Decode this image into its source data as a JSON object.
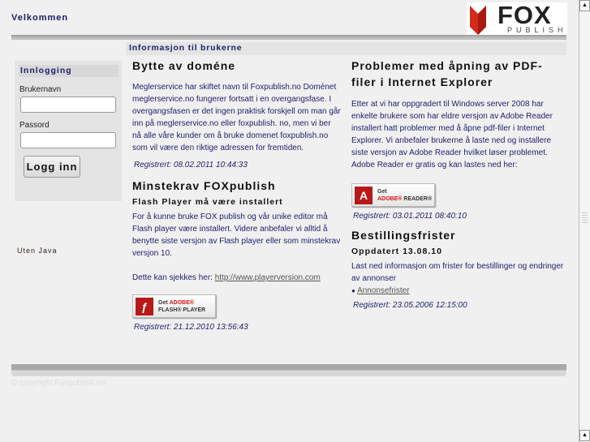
{
  "header": {
    "welcome": "Velkommen",
    "logo_text": "FOX",
    "logo_sub": "PUBLISH"
  },
  "info_bar": "Informasjon til brukerne",
  "login": {
    "title": "Innlogging",
    "username_label": "Brukernavn",
    "username_value": "",
    "password_label": "Passord",
    "password_value": "",
    "submit": "Logg inn"
  },
  "no_java": "Uten Java",
  "col1": {
    "a1": {
      "title": "Bytte av doméne",
      "body": "Meglerservice har skiftet navn til Foxpublish.no Doménet meglerservice.no fungerer fortsatt i en overgangsfase. I overgangsfasen er det ingen praktisk forskjell om man går inn på meglerservice.no eller foxpublish. no, men vi ber nå alle våre kunder om å bruke domenet foxpublish.no som vil være den riktige adressen for fremtiden.",
      "reg": "Registrert: 08.02.2011 10:44:33"
    },
    "a2": {
      "title": "Minstekrav FOXpublish",
      "sub": "Flash Player må være installert",
      "body": "For å kunne bruke FOX publish og vår unike editor må Flash player være installert. Videre anbefaler vi alltid å benytte siste versjon av Flash player eller som minstekrav versjon 10.",
      "check": "Dette kan sjekkes her: ",
      "link": "http://www.playerversion.com",
      "badge_get": "Get",
      "badge_brand": "ADOBE®",
      "badge_product": "FLASH® PLAYER",
      "reg": "Registrert: 21.12.2010 13:56:43"
    }
  },
  "col2": {
    "a1": {
      "title": "Problemer med åpning av PDF-filer i Internet Explorer",
      "body": "Etter at vi har oppgradert til Windows server 2008 har enkelte brukere som har eldre versjon av Adobe Reader installert hatt problemer med å åpne pdf-filer i Internet Explorer. Vi anbefaler brukerne å laste ned og installere siste versjon av Adobe Reader hvilket løser problemet. Adobe Reader er gratis og kan lastes ned her:",
      "badge_get": "Get",
      "badge_brand": "ADOBE®",
      "badge_product": "READER®",
      "reg": "Registrert: 03.01.2011 08:40:10"
    },
    "a2": {
      "title": "Bestillingsfrister",
      "sub": "Oppdatert 13.08.10",
      "body": "Last ned informasjon om frister for bestillinger og endringer av annonser",
      "link": "Annonsefrister",
      "reg": "Registrert: 23.05.2006 12:15:00"
    }
  },
  "footer": {
    "copyright": "© copyright Foxpublish.no"
  }
}
